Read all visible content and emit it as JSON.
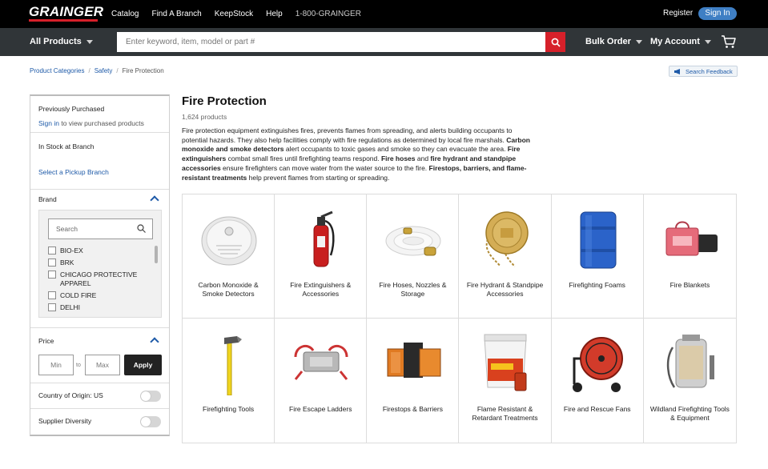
{
  "header": {
    "logo": "GRAINGER",
    "nav": [
      "Catalog",
      "Find A Branch",
      "KeepStock",
      "Help"
    ],
    "phone": "1-800-GRAINGER",
    "register": "Register",
    "signin": "Sign In"
  },
  "searchbar": {
    "all_products": "All Products",
    "placeholder": "Enter keyword, item, model or part #",
    "bulk_order": "Bulk Order",
    "my_account": "My Account"
  },
  "breadcrumb": {
    "items": [
      "Product Categories",
      "Safety"
    ],
    "current": "Fire Protection",
    "feedback": "Search Feedback"
  },
  "sidebar": {
    "previously_purchased": "Previously Purchased",
    "signin_link": "Sign in",
    "signin_rest": " to view purchased products",
    "in_stock": "In Stock at Branch",
    "pickup": "Select a Pickup Branch",
    "brand_title": "Brand",
    "brand_search_placeholder": "Search",
    "brands": [
      "BIO-EX",
      "BRK",
      "CHICAGO PROTECTIVE APPAREL",
      "COLD FIRE",
      "DELHI"
    ],
    "price_title": "Price",
    "min_placeholder": "Min",
    "max_placeholder": "Max",
    "to": "to",
    "apply": "Apply",
    "country": "Country of Origin: US",
    "supplier": "Supplier Diversity"
  },
  "main": {
    "title": "Fire Protection",
    "count": "1,624 products",
    "desc": {
      "p1": "Fire protection equipment extinguishes fires, prevents flames from spreading, and alerts building occupants to potential hazards. They also help facilities comply with fire regulations as determined by local fire marshals. ",
      "b1": "Carbon monoxide and smoke detectors",
      "p2": " alert occupants to toxic gases and smoke so they can evacuate the area. ",
      "b2": "Fire extinguishers",
      "p3": " combat small fires until firefighting teams respond. ",
      "b3": "Fire hoses",
      "p4": " and ",
      "b4": "fire hydrant and standpipe accessories",
      "p5": " ensure firefighters can move water from the water source to the fire. ",
      "b5": "Firestops, barriers, and flame-resistant treatments",
      "p6": " help prevent flames from starting or spreading."
    },
    "categories": [
      {
        "label": "Carbon Monoxide & Smoke Detectors",
        "icon": "smoke-detector-icon"
      },
      {
        "label": "Fire Extinguishers & Accessories",
        "icon": "fire-extinguisher-icon"
      },
      {
        "label": "Fire Hoses, Nozzles & Storage",
        "icon": "fire-hose-icon"
      },
      {
        "label": "Fire Hydrant & Standpipe Accessories",
        "icon": "hydrant-cap-icon"
      },
      {
        "label": "Firefighting Foams",
        "icon": "foam-drum-icon"
      },
      {
        "label": "Fire Blankets",
        "icon": "fire-blanket-icon"
      },
      {
        "label": "Firefighting Tools",
        "icon": "axe-icon"
      },
      {
        "label": "Fire Escape Ladders",
        "icon": "escape-ladder-icon"
      },
      {
        "label": "Firestops & Barriers",
        "icon": "firestop-icon"
      },
      {
        "label": "Flame Resistant & Retardant Treatments",
        "icon": "fireguard-bucket-icon"
      },
      {
        "label": "Fire and Rescue Fans",
        "icon": "rescue-fan-icon"
      },
      {
        "label": "Wildland Firefighting Tools & Equipment",
        "icon": "backpack-pump-icon"
      }
    ]
  }
}
